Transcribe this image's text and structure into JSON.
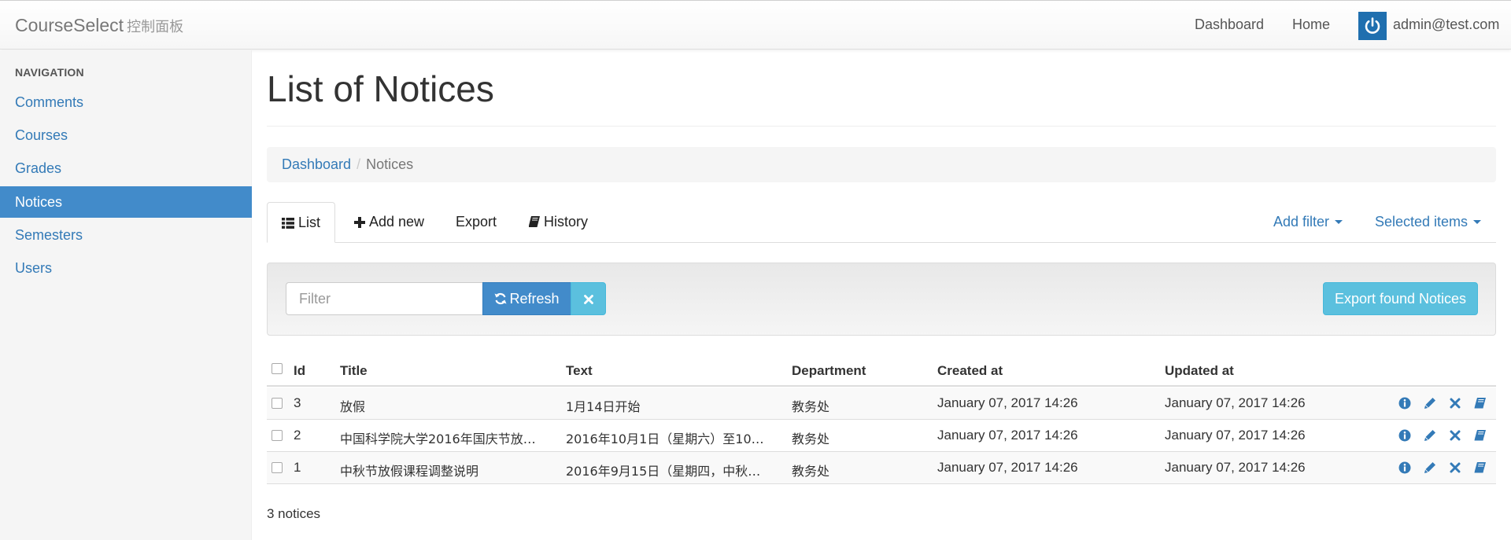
{
  "app": {
    "brand": "CourseSelect",
    "brand_sub": "控制面板"
  },
  "topnav": {
    "links": [
      "Dashboard",
      "Home"
    ],
    "user_email": "admin@test.com"
  },
  "sidebar": {
    "heading": "NAVIGATION",
    "items": [
      {
        "label": "Comments",
        "active": false
      },
      {
        "label": "Courses",
        "active": false
      },
      {
        "label": "Grades",
        "active": false
      },
      {
        "label": "Notices",
        "active": true
      },
      {
        "label": "Semesters",
        "active": false
      },
      {
        "label": "Users",
        "active": false
      }
    ]
  },
  "page": {
    "title": "List of Notices"
  },
  "breadcrumb": {
    "items": [
      "Dashboard",
      "Notices"
    ],
    "separator": "/"
  },
  "tabs": {
    "list": "List",
    "add_new": "Add new",
    "export": "Export",
    "history": "History",
    "add_filter": "Add filter",
    "selected_items": "Selected items"
  },
  "filter": {
    "placeholder": "Filter",
    "value": "",
    "refresh_label": "Refresh",
    "export_found_label": "Export found Notices"
  },
  "table": {
    "columns": [
      "Id",
      "Title",
      "Text",
      "Department",
      "Created at",
      "Updated at"
    ],
    "rows": [
      {
        "id": "3",
        "title": "放假",
        "text": "1月14日开始",
        "department": "教务处",
        "created_at": "January 07, 2017 14:26",
        "updated_at": "January 07, 2017 14:26"
      },
      {
        "id": "2",
        "title": "中国科学院大学2016年国庆节放…",
        "text": "2016年10月1日（星期六）至10…",
        "department": "教务处",
        "created_at": "January 07, 2017 14:26",
        "updated_at": "January 07, 2017 14:26"
      },
      {
        "id": "1",
        "title": "中秋节放假课程调整说明",
        "text": "2016年9月15日（星期四，中秋…",
        "department": "教务处",
        "created_at": "January 07, 2017 14:26",
        "updated_at": "January 07, 2017 14:26"
      }
    ],
    "row_actions": [
      "info-icon",
      "edit-pencil-icon",
      "delete-x-icon",
      "history-book-icon"
    ],
    "count_text": "3 notices"
  },
  "colors": {
    "link": "#337ab7",
    "primary": "#428bca",
    "info": "#5bc0de",
    "user_badge": "#1f6faf"
  }
}
